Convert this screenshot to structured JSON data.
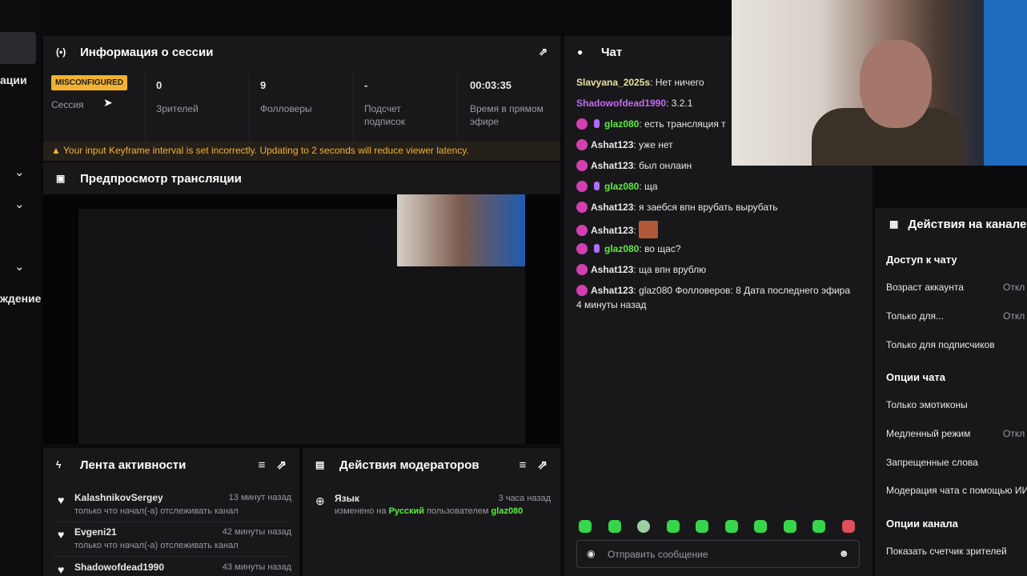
{
  "sidebar": {
    "label_1": "ации",
    "label_2": "ждение"
  },
  "session": {
    "title": "Информация о сессии",
    "status_badge": "MISCONFIGURED",
    "status_label": "Сессия",
    "viewers_value": "0",
    "viewers_label": "Зрителей",
    "followers_value": "9",
    "followers_label": "Фолловеры",
    "subs_value": "-",
    "subs_label": "Подсчет подписок",
    "uptime_value": "00:03:35",
    "uptime_label": "Время в прямом эфире",
    "warning": "Your input Keyframe interval is set incorrectly. Updating to 2 seconds will reduce viewer latency."
  },
  "preview": {
    "title": "Предпросмотр трансляции"
  },
  "activity": {
    "title": "Лента активности",
    "items": [
      {
        "user": "KalashnikovSergey",
        "time": "13 минут назад",
        "desc": "только что начал(-а) отслеживать канал"
      },
      {
        "user": "Evgeni21",
        "time": "42 минуты назад",
        "desc": "только что начал(-а) отслеживать канал"
      },
      {
        "user": "Shadowofdead1990",
        "time": "43 минуты назад",
        "desc": ""
      }
    ]
  },
  "mods": {
    "title": "Действия модераторов",
    "item": {
      "label": "Язык",
      "time": "3 часа назад",
      "desc_prefix": "изменено на",
      "lang": "Русский",
      "desc_mid": "пользователем",
      "user": "glaz080"
    }
  },
  "chat": {
    "title": "Чат",
    "messages": [
      {
        "user": "Slavyana_2025s",
        "text": ": Нет ничего",
        "color": "#e8e2a0"
      },
      {
        "user": "Shadowofdead1990",
        "text": ": 3.2.1",
        "color": "#c56bf0"
      },
      {
        "user": "glaz080",
        "text": ": есть трансляция т",
        "color": "#5eea42"
      },
      {
        "user": "Ashat123",
        "text": ": уже нет",
        "color": "#e8e8e8"
      },
      {
        "user": "Ashat123",
        "text": ": был онлаин",
        "color": "#e8e8e8"
      },
      {
        "user": "glaz080",
        "text": ": ща",
        "color": "#5eea42"
      },
      {
        "user": "Ashat123",
        "text": ": я заебся впн врубать вырубать",
        "color": "#e8e8e8"
      },
      {
        "user": "Ashat123",
        "text": ":",
        "color": "#e8e8e8"
      },
      {
        "user": "glaz080",
        "text": ": во щас?",
        "color": "#5eea42"
      },
      {
        "user": "Ashat123",
        "text": ": ща впн врублю",
        "color": "#e8e8e8"
      },
      {
        "user": "Ashat123",
        "text": ": glaz080 Фолловеров: 8 Дата последнего эфира",
        "color": "#e8e8e8"
      }
    ],
    "last_line": "4 минуты назад",
    "input_placeholder": "Отправить сообщение"
  },
  "actions": {
    "title": "Действия на канале",
    "chat_access": "Доступ к чату",
    "account_age": "Возраст аккаунта",
    "account_age_value": "Откл",
    "only_for": "Только для...",
    "only_for_value": "Откл",
    "subs_only": "Только для подписчиков",
    "chat_options": "Опции чата",
    "emotes_only": "Только эмотиконы",
    "slow_mode": "Медленный режим",
    "slow_mode_value": "Откл",
    "banned_words": "Запрещенные слова",
    "ai_moderation": "Модерация чата с помощью ИИ",
    "channel_options": "Опции канала",
    "show_viewers": "Показать счетчик зрителей"
  }
}
